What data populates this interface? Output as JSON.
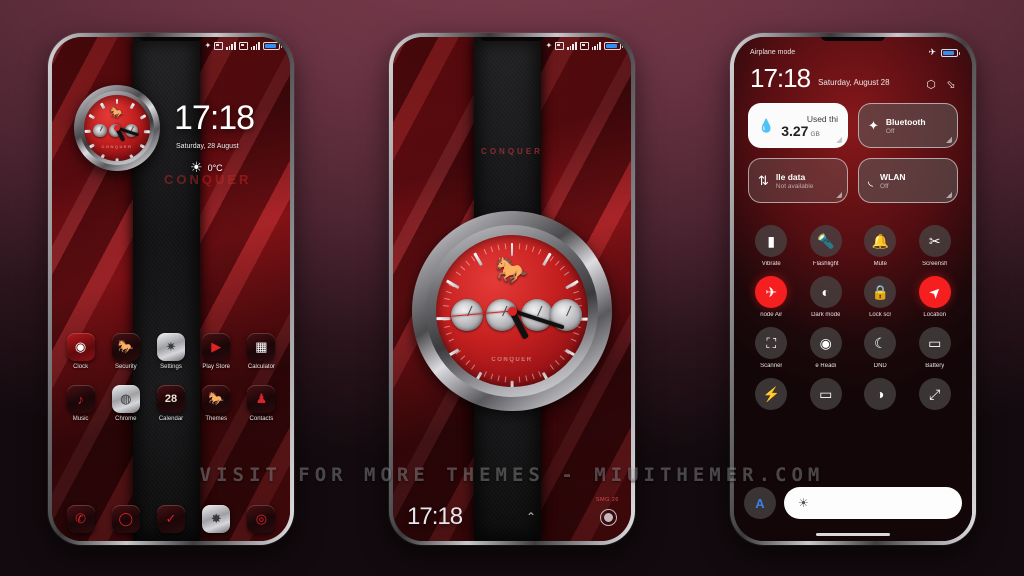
{
  "theme": {
    "name": "CONQUER",
    "accent_red": "#f51f1f",
    "dial_red": "#c41f1f",
    "background_top": "#7a3b4d",
    "background_bottom": "#120a0e"
  },
  "watermark": "VISIT  FOR  MORE  THEMES  -  MIUITHEMER.COM",
  "phone1": {
    "label": "lockscreen-homescreen",
    "status_bar": {
      "icons": [
        "bluetooth-icon",
        "sim1-icon",
        "signal-bars-icon",
        "sim2-icon",
        "signal-bars-icon",
        "battery-icon"
      ],
      "battery_level": "82"
    },
    "clock_time": "17:18",
    "date": "Saturday, 28 August",
    "weather": {
      "icon": "sun-icon",
      "temperature": "0°C"
    },
    "brand_text": "CONQUER",
    "apps_row1": [
      {
        "label": "Clock",
        "icon": "clock-icon",
        "style": "red"
      },
      {
        "label": "Security",
        "icon": "shield-horse-icon",
        "style": "dark"
      },
      {
        "label": "Settings",
        "icon": "gear-icon",
        "style": "silver"
      },
      {
        "label": "Play Store",
        "icon": "play-triangle-icon",
        "style": "dark"
      },
      {
        "label": "Calculator",
        "icon": "calculator-icon",
        "style": "dark"
      }
    ],
    "apps_row2": [
      {
        "label": "Music",
        "icon": "music-note-icon",
        "style": "dark"
      },
      {
        "label": "Chrome",
        "icon": "chrome-circle-icon",
        "style": "silver"
      },
      {
        "label": "Calendar",
        "icon": "calendar-icon",
        "style": "dark",
        "day": "28"
      },
      {
        "label": "Themes",
        "icon": "themes-horse-icon",
        "style": "dark"
      },
      {
        "label": "Contacts",
        "icon": "person-icon",
        "style": "dark"
      }
    ],
    "dock": [
      {
        "label": "Phone",
        "icon": "phone-handset-icon",
        "style": "dark"
      },
      {
        "label": "Messaging",
        "icon": "message-bubble-icon",
        "style": "dark"
      },
      {
        "label": "Notes",
        "icon": "checkmark-icon",
        "style": "dark"
      },
      {
        "label": "Gallery",
        "icon": "compass-wheel-icon",
        "style": "silver"
      },
      {
        "label": "Camera",
        "icon": "camera-lens-icon",
        "style": "dark"
      }
    ]
  },
  "phone2": {
    "label": "lockscreen-analog-watch",
    "status_bar": {
      "icons": [
        "bluetooth-icon",
        "sim1-icon",
        "signal-bars-icon",
        "sim2-icon",
        "signal-bars-icon",
        "battery-icon"
      ],
      "battery_level": "82"
    },
    "top_brand": "CONQUER",
    "watch_brand": "CONQUER",
    "bottom_time": "17:18",
    "unlock_hint_icon": "chevron-up-icon",
    "camera_icon": "camera-lens-icon",
    "corner_note": "SMG 26"
  },
  "phone3": {
    "label": "control-center",
    "airplane_label": "Airplane mode",
    "status_icons": [
      "airplane-icon",
      "battery-icon"
    ],
    "time": "17:18",
    "date": "Saturday, August 28",
    "header_actions": [
      {
        "name": "settings-gear-icon",
        "glyph": "⬡"
      },
      {
        "name": "edit-icon",
        "glyph": "◸"
      }
    ],
    "big_tiles": [
      {
        "title": "Used thi",
        "value": "3.27",
        "unit": "GB",
        "icon": "data-drop-icon",
        "state": "light"
      },
      {
        "title": "Bluetooth",
        "subtitle": "Off",
        "icon": "bluetooth-icon",
        "state": "dark"
      },
      {
        "title": "lle data",
        "subtitle": "Not available",
        "icon": "mobile-data-icon",
        "state": "dark-dim"
      },
      {
        "title": "WLAN",
        "subtitle": "Off",
        "icon": "wifi-icon",
        "state": "dark"
      }
    ],
    "toggles": [
      {
        "label": "Vibrate",
        "icon": "vibrate-icon",
        "on": false
      },
      {
        "label": "Flashlight",
        "icon": "flashlight-icon",
        "on": false
      },
      {
        "label": "Mute",
        "icon": "bell-icon",
        "on": false
      },
      {
        "label": "Screensh",
        "icon": "scissors-screenshot-icon",
        "on": false
      },
      {
        "label": "node    Air",
        "icon": "airplane-icon",
        "on": true
      },
      {
        "label": "Dark mode",
        "icon": "contrast-circle-icon",
        "on": false
      },
      {
        "label": "Lock scr",
        "icon": "padlock-icon",
        "on": false
      },
      {
        "label": "Location",
        "icon": "location-arrow-icon",
        "on": true
      },
      {
        "label": "Scanner",
        "icon": "qr-scan-icon",
        "on": false
      },
      {
        "label": "e    Readi",
        "icon": "eye-icon",
        "on": false
      },
      {
        "label": "DND",
        "icon": "moon-icon",
        "on": false
      },
      {
        "label": "Battery",
        "icon": "battery-saver-icon",
        "on": false
      },
      {
        "label": "",
        "icon": "lightning-bolt-icon",
        "on": false
      },
      {
        "label": "",
        "icon": "cast-screen-icon",
        "on": false
      },
      {
        "label": "",
        "icon": "half-contrast-icon",
        "on": false
      },
      {
        "label": "",
        "icon": "rotate-screen-icon",
        "on": false
      }
    ],
    "brightness": {
      "auto_label": "A",
      "icon": "brightness-sun-icon"
    }
  }
}
